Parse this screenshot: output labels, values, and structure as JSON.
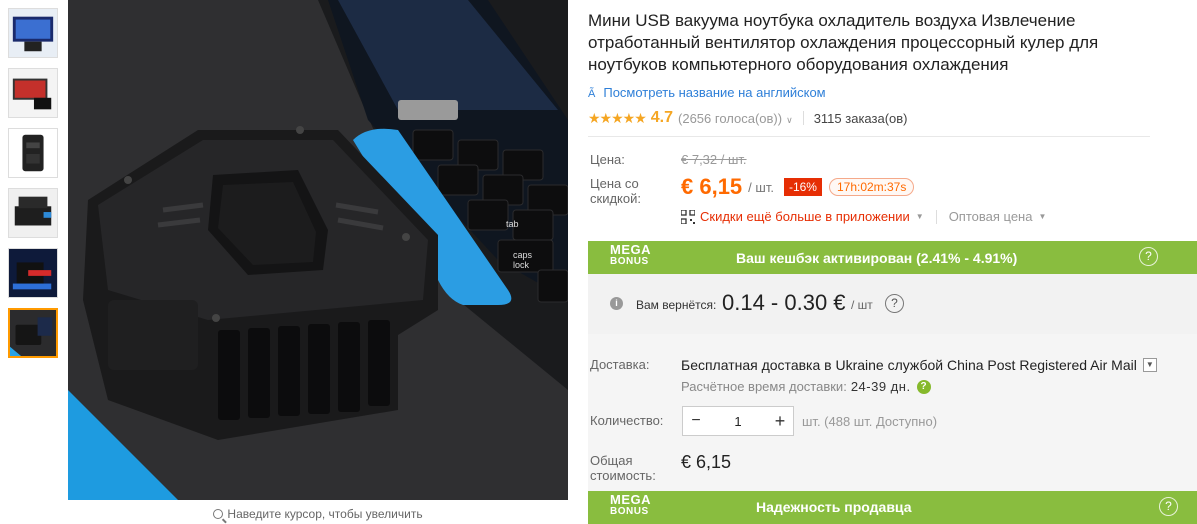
{
  "title": "Мини USB вакуума ноутбука охладитель воздуха Извлечение отработанный вентилятор охлаждения процессорный кулер для ноутбуков компьютерного оборудования охлаждения",
  "translate_link": "Посмотреть название на английском",
  "rating": {
    "stars": "★★★★★",
    "value": "4.7",
    "count": "(2656 голоса(ов))",
    "orders": "3115 заказа(ов)"
  },
  "price": {
    "label": "Цена:",
    "old": "€ 7,32 / шт.",
    "discount_label": "Цена со скидкой:",
    "new": "€ 6,15",
    "unit": "/ шт.",
    "discount": "-16%",
    "timer": "17h:02m:37s",
    "app_discount": "Скидки ещё больше в приложении",
    "wholesale": "Оптовая цена"
  },
  "mega_bonus": {
    "logo_line1": "MEGA",
    "logo_line2": "BONUS",
    "text": "Ваш кешбэк активирован (2.41% - 4.91%)",
    "help": "?"
  },
  "cashback": {
    "label": "Вам вернётся:",
    "value": "0.14 - 0.30 €",
    "unit": "/ шт",
    "help": "?"
  },
  "shipping": {
    "label": "Доставка:",
    "value": "Бесплатная доставка в Ukraine службой China Post Registered Air Mail",
    "time_label": "Расчётное время доставки:",
    "time_value": "24-39 дн.",
    "help": "?"
  },
  "quantity": {
    "label": "Количество:",
    "value": "1",
    "minus": "−",
    "plus": "+",
    "available": "шт. (488 шт. Доступно)"
  },
  "total": {
    "label": "Общая стоимость:",
    "value": "€ 6,15"
  },
  "seller": {
    "logo_line1": "MEGA",
    "logo_line2": "BONUS",
    "text": "Надежность продавца",
    "help": "?"
  },
  "zoom_hint": "Наведите курсор, чтобы увеличить",
  "colors": {
    "accent": "#ff6a00",
    "mega_green": "#89bd3f",
    "link_blue": "#2e7fd8",
    "discount_red": "#e62e04"
  }
}
